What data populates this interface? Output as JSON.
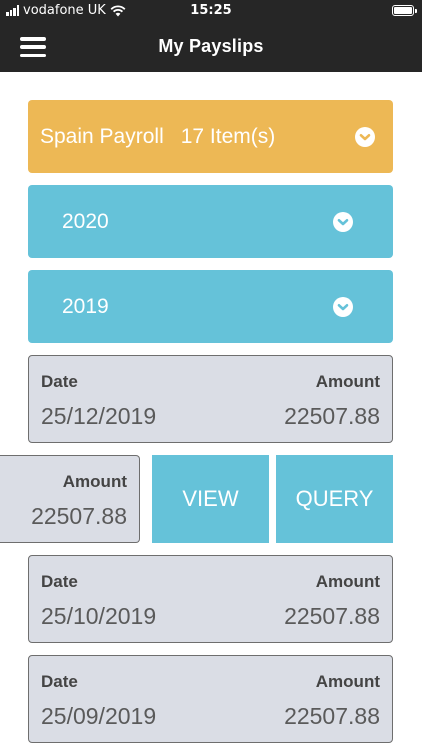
{
  "status_bar": {
    "carrier": "vodafone UK",
    "time": "15:25"
  },
  "header": {
    "title": "My Payslips"
  },
  "payroll": {
    "name": "Spain Payroll",
    "count": "17 Item(s)",
    "color": "#edb855"
  },
  "years": [
    {
      "label": "2020"
    },
    {
      "label": "2019"
    }
  ],
  "labels": {
    "date": "Date",
    "amount": "Amount"
  },
  "payslips": [
    {
      "date": "25/12/2019",
      "amount": "22507.88"
    },
    {
      "date": "",
      "amount": "22507.88"
    },
    {
      "date": "25/10/2019",
      "amount": "22507.88"
    },
    {
      "date": "25/09/2019",
      "amount": "22507.88"
    }
  ],
  "actions": {
    "view": "VIEW",
    "query": "QUERY"
  },
  "colors": {
    "header_bg": "#262626",
    "accent_blue": "#65c2d9",
    "card_bg": "#dadde5"
  }
}
